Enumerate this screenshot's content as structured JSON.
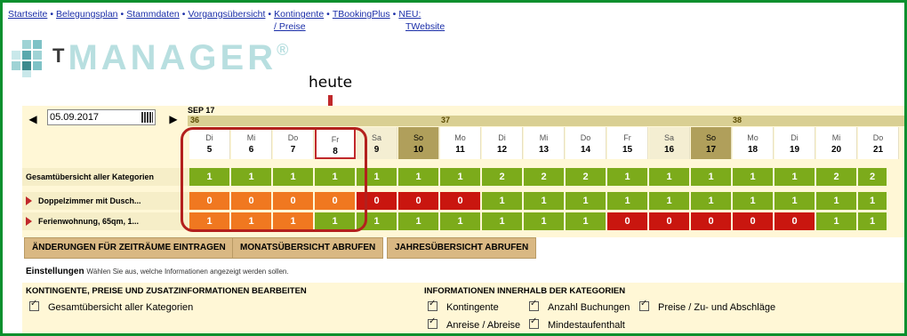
{
  "nav": {
    "items": [
      "Startseite",
      "Belegungsplan",
      "Stammdaten",
      "Vorgangsübersicht",
      "Kontingente",
      "TBookingPlus",
      "NEU:"
    ],
    "sub": [
      "/ Preise",
      "TWebsite"
    ],
    "bullet": "•"
  },
  "logo": {
    "t": "T",
    "name": "MANAGER",
    "reg": "®"
  },
  "annotation": {
    "heute": "heute"
  },
  "calendar": {
    "month": "SEP 17",
    "weeks": [
      "36",
      "37",
      "38"
    ],
    "date_value": "05.09.2017",
    "prev": "◀",
    "next": "▶",
    "days": [
      {
        "n": "Di",
        "d": "5"
      },
      {
        "n": "Mi",
        "d": "6"
      },
      {
        "n": "Do",
        "d": "7"
      },
      {
        "n": "Fr",
        "d": "8"
      },
      {
        "n": "Sa",
        "d": "9"
      },
      {
        "n": "So",
        "d": "10"
      },
      {
        "n": "Mo",
        "d": "11"
      },
      {
        "n": "Di",
        "d": "12"
      },
      {
        "n": "Mi",
        "d": "13"
      },
      {
        "n": "Do",
        "d": "14"
      },
      {
        "n": "Fr",
        "d": "15"
      },
      {
        "n": "Sa",
        "d": "16"
      },
      {
        "n": "So",
        "d": "17"
      },
      {
        "n": "Mo",
        "d": "18"
      },
      {
        "n": "Di",
        "d": "19"
      },
      {
        "n": "Mi",
        "d": "20"
      },
      {
        "n": "Do",
        "d": "21"
      }
    ],
    "rows": [
      {
        "label": "Gesamtübersicht aller Kategorien",
        "values": [
          "1",
          "1",
          "1",
          "1",
          "1",
          "1",
          "1",
          "2",
          "2",
          "2",
          "1",
          "1",
          "1",
          "1",
          "1",
          "2",
          "2"
        ],
        "colors": [
          "g",
          "g",
          "g",
          "g",
          "g",
          "g",
          "g",
          "g",
          "g",
          "g",
          "g",
          "g",
          "g",
          "g",
          "g",
          "g",
          "g"
        ]
      },
      {
        "label": "Doppelzimmer mit Dusch...",
        "values": [
          "0",
          "0",
          "0",
          "0",
          "0",
          "0",
          "0",
          "1",
          "1",
          "1",
          "1",
          "1",
          "1",
          "1",
          "1",
          "1",
          "1"
        ],
        "colors": [
          "o",
          "o",
          "o",
          "o",
          "r",
          "r",
          "r",
          "g",
          "g",
          "g",
          "g",
          "g",
          "g",
          "g",
          "g",
          "g",
          "g"
        ]
      },
      {
        "label": "Ferienwohnung, 65qm, 1...",
        "values": [
          "1",
          "1",
          "1",
          "1",
          "1",
          "1",
          "1",
          "1",
          "1",
          "1",
          "0",
          "0",
          "0",
          "0",
          "0",
          "1",
          "1"
        ],
        "colors": [
          "o",
          "o",
          "o",
          "g",
          "g",
          "g",
          "g",
          "g",
          "g",
          "g",
          "r",
          "r",
          "r",
          "r",
          "r",
          "g",
          "g"
        ]
      }
    ]
  },
  "buttons": {
    "changes": "ÄNDERUNGEN FÜR ZEITRÄUME EINTRAGEN",
    "month": "MONATSÜBERSICHT ABRUFEN",
    "year": "JAHRESÜBERSICHT ABRUFEN"
  },
  "settings": {
    "title": "Einstellungen",
    "hint": "Wählen Sie aus, welche Informationen angezeigt werden sollen.",
    "left_title": "KONTINGENTE, PREISE UND ZUSATZINFORMATIONEN BEARBEITEN",
    "left_option": "Gesamtübersicht aller Kategorien",
    "right_title": "INFORMATIONEN INNERHALB DER KATEGORIEN",
    "options": [
      "Kontingente",
      "Anzahl Buchungen",
      "Preise / Zu- und Abschläge",
      "Anreise / Abreise",
      "Mindestaufenthalt"
    ]
  },
  "colors": {
    "green": "#7cab1b",
    "orange": "#f07820",
    "red": "#c9160f",
    "border": "#0a8f2e",
    "highlight": "#b3201d"
  }
}
